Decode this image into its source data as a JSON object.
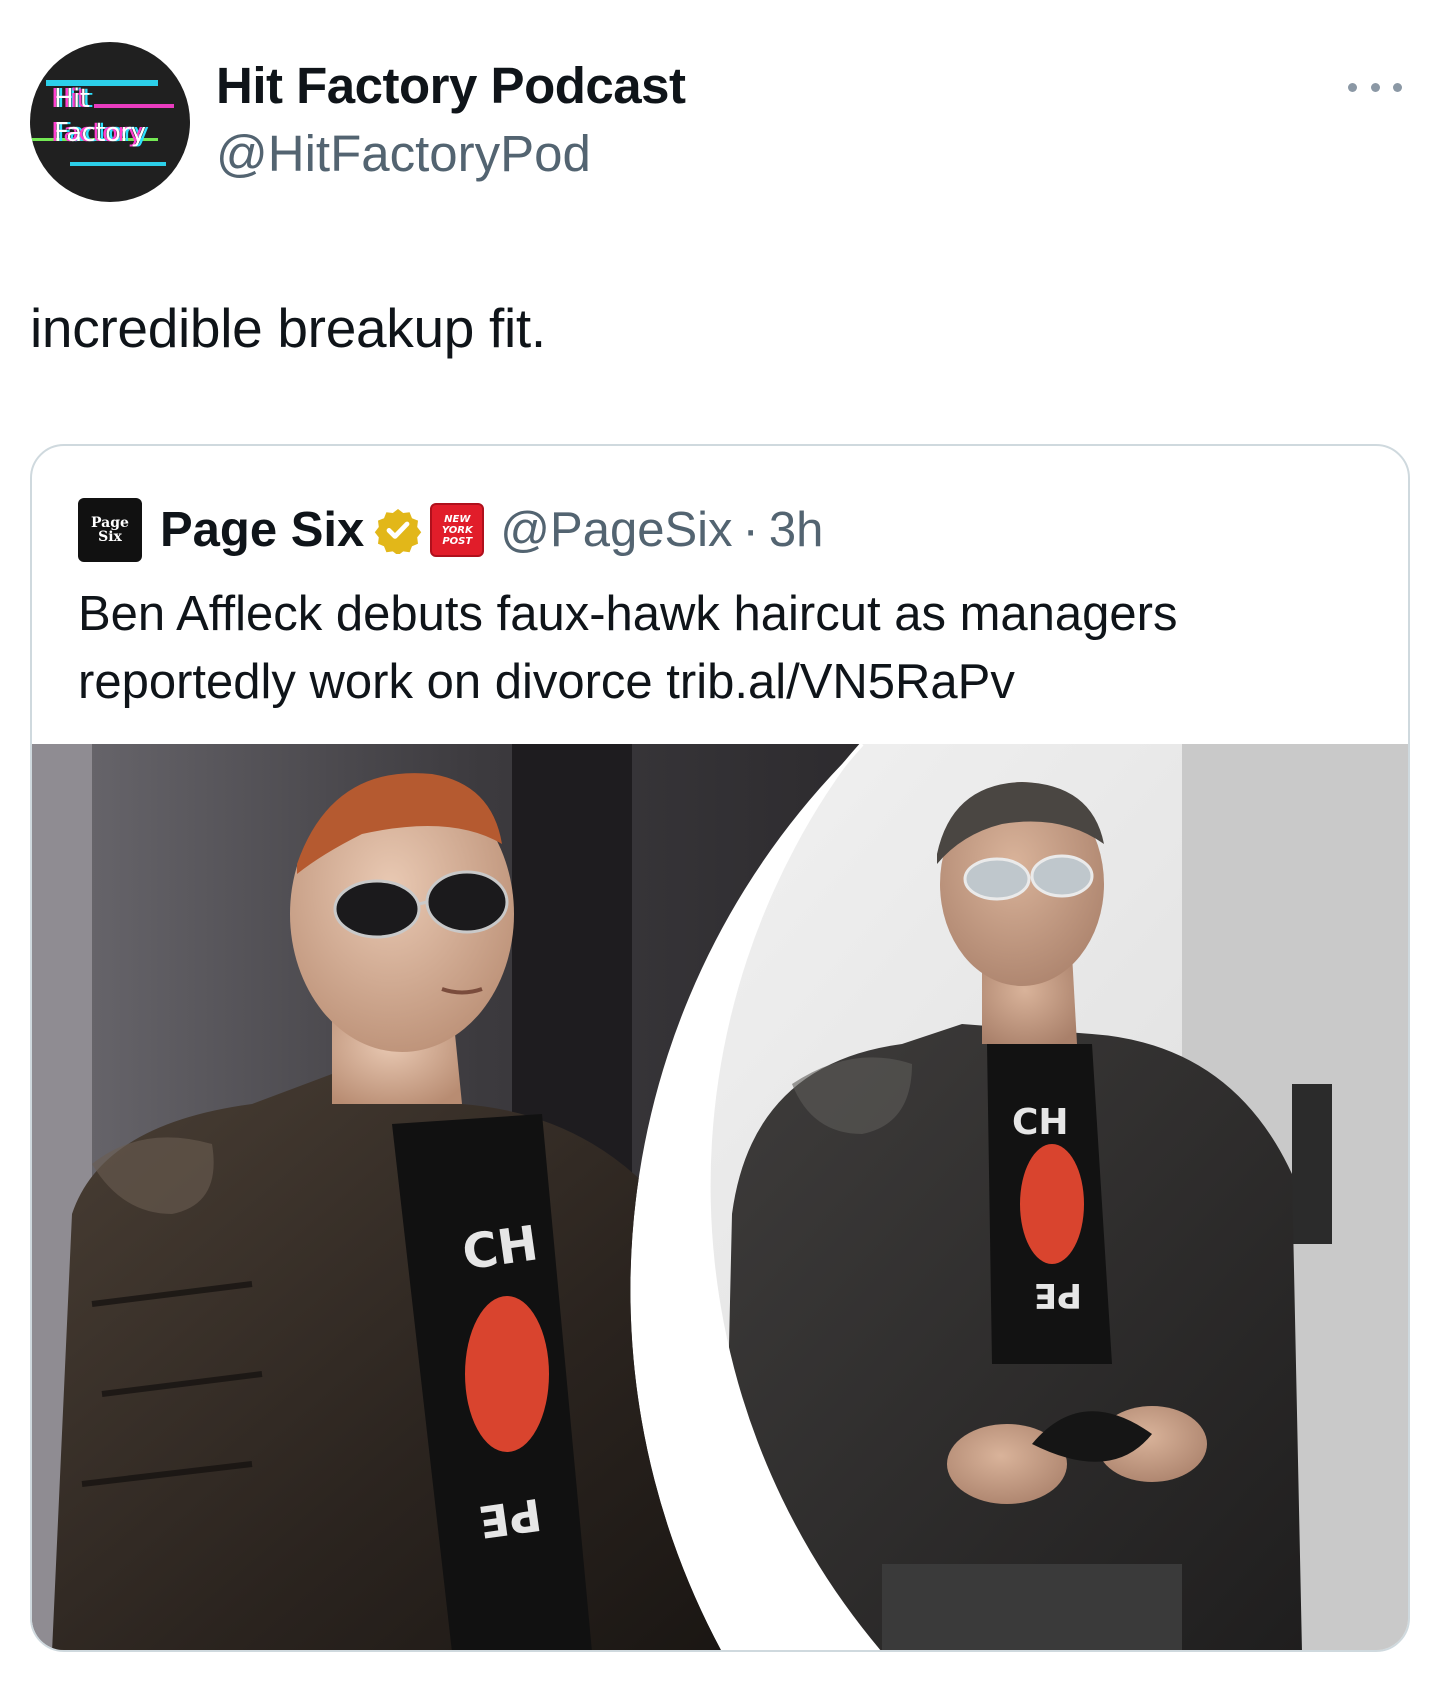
{
  "author": {
    "display_name": "Hit Factory Podcast",
    "handle": "@HitFactoryPod",
    "avatar_text": [
      "Hit",
      "Factory"
    ]
  },
  "tweet": {
    "text": "incredible breakup fit."
  },
  "quoted": {
    "logo_text": [
      "Page",
      "Six"
    ],
    "display_name": "Page Six",
    "affiliate_badge_text": [
      "NEW",
      "YORK",
      "POST"
    ],
    "handle": "@PageSix",
    "separator": "·",
    "time": "3h",
    "text": "Ben Affleck debuts faux-hawk haircut as managers reportedly work on divorce trib.al/VN5RaPv",
    "photo_shirt_text": [
      "CH",
      "CH",
      "PE",
      "PE"
    ]
  },
  "icons": {
    "more": "more-horizontal-icon",
    "verified": "verified-badge-icon"
  },
  "colors": {
    "text_primary": "#0f1419",
    "text_secondary": "#536471",
    "border": "#cfd9de",
    "verified_gold": "#e2b719",
    "nyp_red": "#e11d2a"
  }
}
